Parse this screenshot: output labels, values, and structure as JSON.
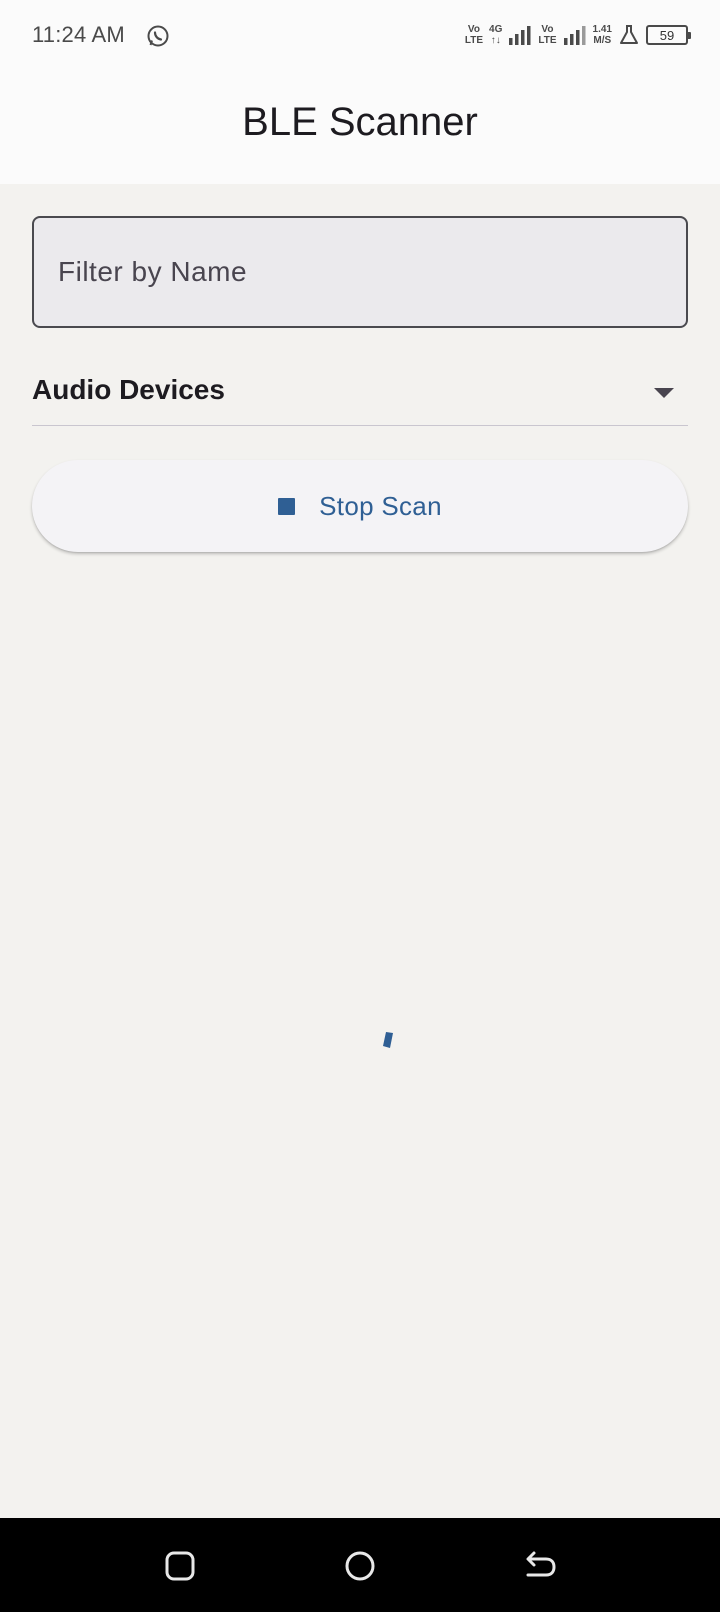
{
  "status_bar": {
    "time": "11:24 AM",
    "volte1_top": "Vo",
    "volte1_bottom": "LTE",
    "net_type_top": "4G",
    "net_type_bottom": "↑↓",
    "volte2_top": "Vo",
    "volte2_bottom": "LTE",
    "speed_value": "1.41",
    "speed_unit": "M/S",
    "battery_level": "59"
  },
  "app_bar": {
    "title": "BLE Scanner"
  },
  "filter": {
    "placeholder": "Filter by Name",
    "value": ""
  },
  "dropdown": {
    "selected": "Audio Devices"
  },
  "scan_button": {
    "label": "Stop Scan"
  },
  "colors": {
    "accent": "#2f5f94",
    "background": "#f3f2ef",
    "app_bar_bg": "#fbfbfb",
    "nav_bar_bg": "#000000"
  }
}
